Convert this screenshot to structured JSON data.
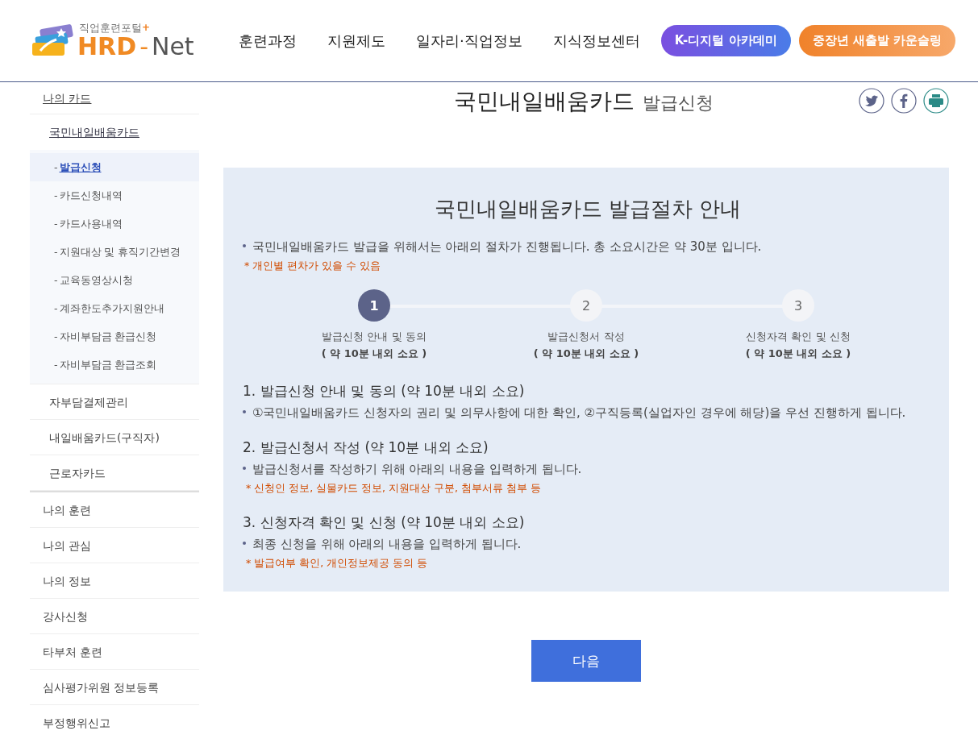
{
  "header": {
    "logo": {
      "tagline": "직업훈련포털",
      "tagline_mark": "+",
      "brand": "HRD",
      "separator": "-",
      "brand_tail": "Net"
    },
    "nav": [
      {
        "label": "훈련과정"
      },
      {
        "label": "지원제도"
      },
      {
        "label": "일자리·직업정보"
      },
      {
        "label": "지식정보센터"
      }
    ],
    "buttons": [
      {
        "label": "K-디지털 아카데미",
        "kind": "purple"
      },
      {
        "label": "중장년 새출발 카운슬링",
        "kind": "orange"
      }
    ]
  },
  "sidebar": {
    "items": [
      {
        "label": "나의 카드",
        "children": [
          {
            "label": "국민내일배움카드",
            "children": [
              {
                "bullet": "-",
                "label": "발급신청",
                "selected": true
              },
              {
                "bullet": "-",
                "label": "카드신청내역",
                "selected": false
              },
              {
                "bullet": "-",
                "label": "카드사용내역",
                "selected": false
              },
              {
                "bullet": "-",
                "label": "지원대상 및 휴직기간변경",
                "selected": false
              },
              {
                "bullet": "-",
                "label": "교육동영상시청",
                "selected": false
              },
              {
                "bullet": "-",
                "label": "계좌한도추가지원안내",
                "selected": false
              },
              {
                "bullet": "-",
                "label": "자비부담금 환급신청",
                "selected": false
              },
              {
                "bullet": "-",
                "label": "자비부담금 환급조회",
                "selected": false
              }
            ]
          },
          {
            "label": "자부담결제관리"
          },
          {
            "label": "내일배움카드(구직자)"
          },
          {
            "label": "근로자카드"
          }
        ]
      },
      {
        "label": "나의 훈련"
      },
      {
        "label": "나의 관심"
      },
      {
        "label": "나의 정보"
      },
      {
        "label": "강사신청"
      },
      {
        "label": "타부처 훈련"
      },
      {
        "label": "심사평가위원 정보등록"
      },
      {
        "label": "부정행위신고"
      }
    ]
  },
  "page_title": {
    "main": "국민내일배움카드",
    "sub": "발급신청"
  },
  "share": [
    {
      "kind": "twitter"
    },
    {
      "kind": "facebook"
    },
    {
      "kind": "print"
    }
  ],
  "guide": {
    "heading": "국민내일배움카드 발급절차 안내",
    "intro": "국민내일배움카드 발급을 위해서는 아래의 절차가 진행됩니다. 총 소요시간은 약 30분 입니다.",
    "intro_note": "* 개인별 편차가 있을 수 있음",
    "steps": [
      {
        "number": "1",
        "label": "발급신청 안내 및 동의",
        "duration": "( 약 10분 내외 소요 )",
        "selected": true
      },
      {
        "number": "2",
        "label": "발급신청서 작성",
        "duration": "( 약 10분 내외 소요 )",
        "selected": false
      },
      {
        "number": "3",
        "label": "신청자격 확인 및 신청",
        "duration": "( 약 10분 내외 소요 )",
        "selected": false
      }
    ],
    "sections": [
      {
        "title": "1. 발급신청 안내 및 동의 (약 10분 내외 소요)",
        "text": "①국민내일배움카드 신청자의 권리 및 의무사항에 대한 확인, ②구직등록(실업자인 경우에 해당)을 우선 진행하게 됩니다."
      },
      {
        "title": "2. 발급신청서 작성 (약 10분 내외 소요)",
        "text": "발급신청서를 작성하기 위해 아래의 내용을 입력하게 됩니다.",
        "note": "* 신청인 정보, 실물카드 정보, 지원대상 구분, 첨부서류 첨부 등"
      },
      {
        "title": "3. 신청자격 확인 및 신청 (약 10분 내외 소요)",
        "text": "최종 신청을 위해 아래의 내용을 입력하게 됩니다.",
        "note": "* 발급여부 확인, 개인정보제공 동의 등"
      }
    ]
  },
  "next_button": {
    "label": "다음"
  }
}
